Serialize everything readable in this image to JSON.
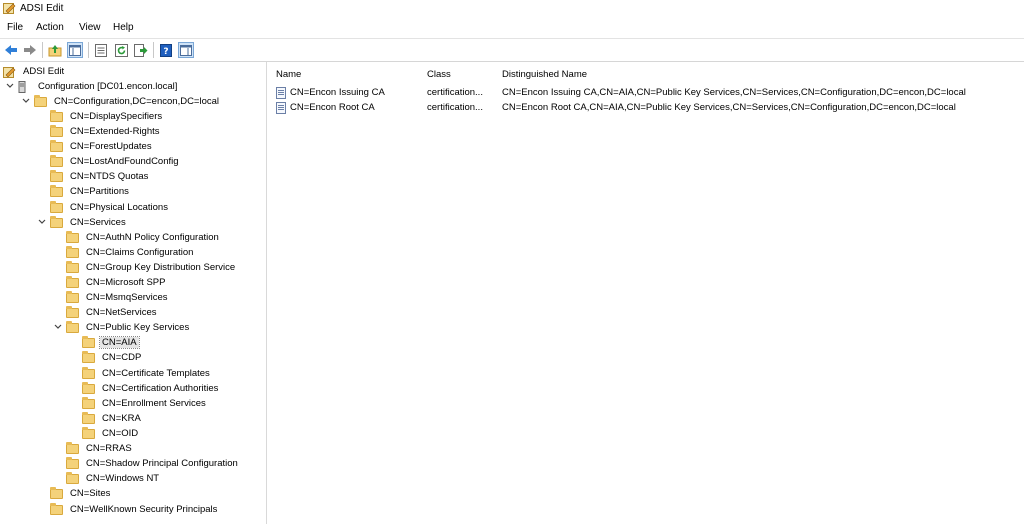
{
  "window": {
    "title": "ADSI Edit"
  },
  "menu": [
    "File",
    "Action",
    "View",
    "Help"
  ],
  "toolbar": {
    "buttons": [
      "back-icon",
      "forward-icon",
      "up-folder-icon",
      "show-hide-tree-icon",
      "properties-icon",
      "refresh-icon",
      "export-list-icon",
      "help-icon",
      "show-hide-action-pane-icon"
    ]
  },
  "tree": {
    "root": "ADSI Edit",
    "connection": "Configuration [DC01.encon.local]",
    "config_node": "CN=Configuration,DC=encon,DC=local",
    "config_children_a": [
      "CN=DisplaySpecifiers",
      "CN=Extended-Rights",
      "CN=ForestUpdates",
      "CN=LostAndFoundConfig",
      "CN=NTDS Quotas",
      "CN=Partitions",
      "CN=Physical Locations"
    ],
    "services": "CN=Services",
    "services_children_a": [
      "CN=AuthN Policy Configuration",
      "CN=Claims Configuration",
      "CN=Group Key Distribution Service",
      "CN=Microsoft SPP",
      "CN=MsmqServices",
      "CN=NetServices"
    ],
    "pks": "CN=Public Key Services",
    "pks_children": [
      "CN=AIA",
      "CN=CDP",
      "CN=Certificate Templates",
      "CN=Certification Authorities",
      "CN=Enrollment Services",
      "CN=KRA",
      "CN=OID"
    ],
    "services_children_b": [
      "CN=RRAS",
      "CN=Shadow Principal Configuration",
      "CN=Windows NT"
    ],
    "config_children_b": [
      "CN=Sites",
      "CN=WellKnown Security Principals"
    ],
    "selected": "CN=AIA"
  },
  "list": {
    "columns": [
      "Name",
      "Class",
      "Distinguished Name"
    ],
    "rows": [
      {
        "name": "CN=Encon Issuing CA",
        "class": "certification...",
        "dn": "CN=Encon Issuing CA,CN=AIA,CN=Public Key Services,CN=Services,CN=Configuration,DC=encon,DC=local"
      },
      {
        "name": "CN=Encon Root CA",
        "class": "certification...",
        "dn": "CN=Encon Root CA,CN=AIA,CN=Public Key Services,CN=Services,CN=Configuration,DC=encon,DC=local"
      }
    ]
  }
}
